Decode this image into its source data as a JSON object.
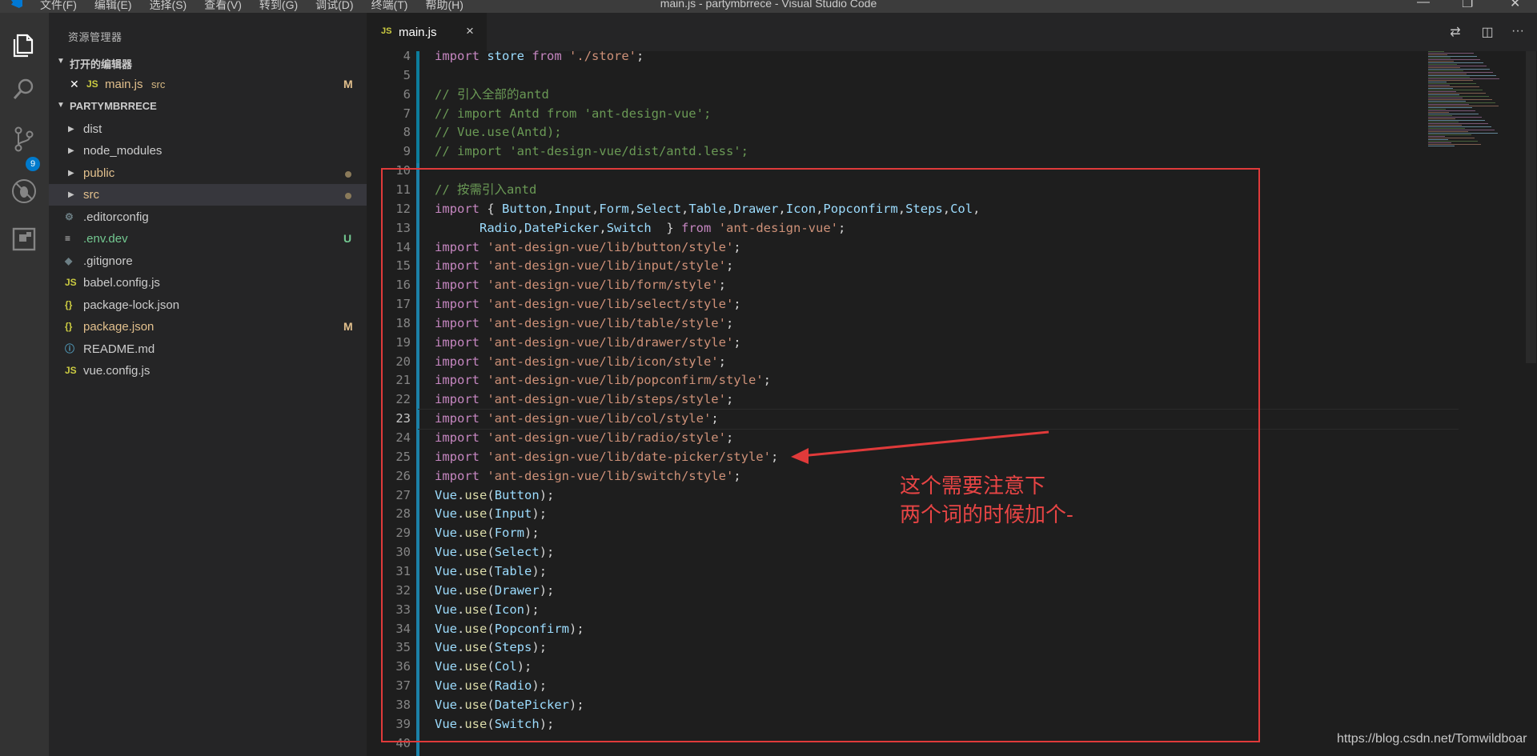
{
  "window": {
    "title": "main.js - partymbrrece - Visual Studio Code",
    "menu": [
      "文件(F)",
      "编辑(E)",
      "选择(S)",
      "查看(V)",
      "转到(G)",
      "调试(D)",
      "终端(T)",
      "帮助(H)"
    ],
    "controls": {
      "minimize": "—",
      "maximize": "❐",
      "close": "✕"
    }
  },
  "activity_bar": {
    "items": [
      "explorer-icon",
      "search-icon",
      "source-control-icon",
      "debug-icon",
      "extensions-icon"
    ],
    "scm_badge": "9"
  },
  "sidebar": {
    "title": "资源管理器",
    "open_editors": {
      "label": "打开的编辑器",
      "items": [
        {
          "icon": "JS",
          "name": "main.js",
          "dir": "src",
          "status": "M"
        }
      ]
    },
    "project": {
      "label": "PARTYMBRRECE",
      "items": [
        {
          "type": "folder",
          "name": "dist",
          "status": ""
        },
        {
          "type": "folder",
          "name": "node_modules",
          "status": ""
        },
        {
          "type": "folder",
          "name": "public",
          "status": "•"
        },
        {
          "type": "folder",
          "name": "src",
          "status": "•"
        },
        {
          "type": "file",
          "icon": "⚙",
          "name": ".editorconfig",
          "status": ""
        },
        {
          "type": "file",
          "icon": "≡",
          "name": ".env.dev",
          "status": "U"
        },
        {
          "type": "file",
          "icon": "◆",
          "name": ".gitignore",
          "status": ""
        },
        {
          "type": "file",
          "icon": "JS",
          "name": "babel.config.js",
          "status": ""
        },
        {
          "type": "file",
          "icon": "{}",
          "name": "package-lock.json",
          "status": ""
        },
        {
          "type": "file",
          "icon": "{}",
          "name": "package.json",
          "status": "M"
        },
        {
          "type": "file",
          "icon": "ⓘ",
          "name": "README.md",
          "status": ""
        },
        {
          "type": "file",
          "icon": "JS",
          "name": "vue.config.js",
          "status": ""
        }
      ]
    }
  },
  "tabs": {
    "active": {
      "icon": "JS",
      "label": "main.js",
      "close": "×"
    },
    "actions": [
      "⇄",
      "◫",
      "···"
    ]
  },
  "editor": {
    "current_line": "23",
    "lines": [
      {
        "n": "4",
        "parts": [
          [
            "kw",
            "import"
          ],
          [
            "pn",
            " "
          ],
          [
            "vr",
            "store"
          ],
          [
            "pn",
            " "
          ],
          [
            "kw",
            "from"
          ],
          [
            "pn",
            " "
          ],
          [
            "str",
            "'./store'"
          ],
          [
            "pn",
            ";"
          ]
        ]
      },
      {
        "n": "5",
        "parts": []
      },
      {
        "n": "6",
        "parts": [
          [
            "cmt",
            "// 引入全部的antd"
          ]
        ]
      },
      {
        "n": "7",
        "parts": [
          [
            "cmt",
            "// import Antd from 'ant-design-vue';"
          ]
        ]
      },
      {
        "n": "8",
        "parts": [
          [
            "cmt",
            "// Vue.use(Antd);"
          ]
        ]
      },
      {
        "n": "9",
        "parts": [
          [
            "cmt",
            "// import 'ant-design-vue/dist/antd.less';"
          ]
        ]
      },
      {
        "n": "10",
        "parts": []
      },
      {
        "n": "11",
        "parts": [
          [
            "cmt",
            "// 按需引入antd"
          ]
        ]
      },
      {
        "n": "12",
        "parts": [
          [
            "kw",
            "import"
          ],
          [
            "pn",
            " { "
          ],
          [
            "vr",
            "Button"
          ],
          [
            "pn",
            ","
          ],
          [
            "vr",
            "Input"
          ],
          [
            "pn",
            ","
          ],
          [
            "vr",
            "Form"
          ],
          [
            "pn",
            ","
          ],
          [
            "vr",
            "Select"
          ],
          [
            "pn",
            ","
          ],
          [
            "vr",
            "Table"
          ],
          [
            "pn",
            ","
          ],
          [
            "vr",
            "Drawer"
          ],
          [
            "pn",
            ","
          ],
          [
            "vr",
            "Icon"
          ],
          [
            "pn",
            ","
          ],
          [
            "vr",
            "Popconfirm"
          ],
          [
            "pn",
            ","
          ],
          [
            "vr",
            "Steps"
          ],
          [
            "pn",
            ","
          ],
          [
            "vr",
            "Col"
          ],
          [
            "pn",
            ","
          ]
        ]
      },
      {
        "n": "13",
        "parts": [
          [
            "pn",
            "      "
          ],
          [
            "vr",
            "Radio"
          ],
          [
            "pn",
            ","
          ],
          [
            "vr",
            "DatePicker"
          ],
          [
            "pn",
            ","
          ],
          [
            "vr",
            "Switch"
          ],
          [
            "pn",
            "  } "
          ],
          [
            "kw",
            "from"
          ],
          [
            "pn",
            " "
          ],
          [
            "str",
            "'ant-design-vue'"
          ],
          [
            "pn",
            ";"
          ]
        ]
      },
      {
        "n": "14",
        "parts": [
          [
            "kw",
            "import"
          ],
          [
            "pn",
            " "
          ],
          [
            "str",
            "'ant-design-vue/lib/button/style'"
          ],
          [
            "pn",
            ";"
          ]
        ]
      },
      {
        "n": "15",
        "parts": [
          [
            "kw",
            "import"
          ],
          [
            "pn",
            " "
          ],
          [
            "str",
            "'ant-design-vue/lib/input/style'"
          ],
          [
            "pn",
            ";"
          ]
        ]
      },
      {
        "n": "16",
        "parts": [
          [
            "kw",
            "import"
          ],
          [
            "pn",
            " "
          ],
          [
            "str",
            "'ant-design-vue/lib/form/style'"
          ],
          [
            "pn",
            ";"
          ]
        ]
      },
      {
        "n": "17",
        "parts": [
          [
            "kw",
            "import"
          ],
          [
            "pn",
            " "
          ],
          [
            "str",
            "'ant-design-vue/lib/select/style'"
          ],
          [
            "pn",
            ";"
          ]
        ]
      },
      {
        "n": "18",
        "parts": [
          [
            "kw",
            "import"
          ],
          [
            "pn",
            " "
          ],
          [
            "str",
            "'ant-design-vue/lib/table/style'"
          ],
          [
            "pn",
            ";"
          ]
        ]
      },
      {
        "n": "19",
        "parts": [
          [
            "kw",
            "import"
          ],
          [
            "pn",
            " "
          ],
          [
            "str",
            "'ant-design-vue/lib/drawer/style'"
          ],
          [
            "pn",
            ";"
          ]
        ]
      },
      {
        "n": "20",
        "parts": [
          [
            "kw",
            "import"
          ],
          [
            "pn",
            " "
          ],
          [
            "str",
            "'ant-design-vue/lib/icon/style'"
          ],
          [
            "pn",
            ";"
          ]
        ]
      },
      {
        "n": "21",
        "parts": [
          [
            "kw",
            "import"
          ],
          [
            "pn",
            " "
          ],
          [
            "str",
            "'ant-design-vue/lib/popconfirm/style'"
          ],
          [
            "pn",
            ";"
          ]
        ]
      },
      {
        "n": "22",
        "parts": [
          [
            "kw",
            "import"
          ],
          [
            "pn",
            " "
          ],
          [
            "str",
            "'ant-design-vue/lib/steps/style'"
          ],
          [
            "pn",
            ";"
          ]
        ]
      },
      {
        "n": "23",
        "parts": [
          [
            "kw",
            "import"
          ],
          [
            "pn",
            " "
          ],
          [
            "str",
            "'ant-design-vue/lib/col/style'"
          ],
          [
            "pn",
            ";"
          ]
        ]
      },
      {
        "n": "24",
        "parts": [
          [
            "kw",
            "import"
          ],
          [
            "pn",
            " "
          ],
          [
            "str",
            "'ant-design-vue/lib/radio/style'"
          ],
          [
            "pn",
            ";"
          ]
        ]
      },
      {
        "n": "25",
        "parts": [
          [
            "kw",
            "import"
          ],
          [
            "pn",
            " "
          ],
          [
            "str",
            "'ant-design-vue/lib/date-picker/style'"
          ],
          [
            "pn",
            ";"
          ]
        ]
      },
      {
        "n": "26",
        "parts": [
          [
            "kw",
            "import"
          ],
          [
            "pn",
            " "
          ],
          [
            "str",
            "'ant-design-vue/lib/switch/style'"
          ],
          [
            "pn",
            ";"
          ]
        ]
      },
      {
        "n": "27",
        "parts": [
          [
            "vr",
            "Vue"
          ],
          [
            "pn",
            "."
          ],
          [
            "fn",
            "use"
          ],
          [
            "pn",
            "("
          ],
          [
            "vr",
            "Button"
          ],
          [
            "pn",
            ");"
          ]
        ]
      },
      {
        "n": "28",
        "parts": [
          [
            "vr",
            "Vue"
          ],
          [
            "pn",
            "."
          ],
          [
            "fn",
            "use"
          ],
          [
            "pn",
            "("
          ],
          [
            "vr",
            "Input"
          ],
          [
            "pn",
            ");"
          ]
        ]
      },
      {
        "n": "29",
        "parts": [
          [
            "vr",
            "Vue"
          ],
          [
            "pn",
            "."
          ],
          [
            "fn",
            "use"
          ],
          [
            "pn",
            "("
          ],
          [
            "vr",
            "Form"
          ],
          [
            "pn",
            ");"
          ]
        ]
      },
      {
        "n": "30",
        "parts": [
          [
            "vr",
            "Vue"
          ],
          [
            "pn",
            "."
          ],
          [
            "fn",
            "use"
          ],
          [
            "pn",
            "("
          ],
          [
            "vr",
            "Select"
          ],
          [
            "pn",
            ");"
          ]
        ]
      },
      {
        "n": "31",
        "parts": [
          [
            "vr",
            "Vue"
          ],
          [
            "pn",
            "."
          ],
          [
            "fn",
            "use"
          ],
          [
            "pn",
            "("
          ],
          [
            "vr",
            "Table"
          ],
          [
            "pn",
            ");"
          ]
        ]
      },
      {
        "n": "32",
        "parts": [
          [
            "vr",
            "Vue"
          ],
          [
            "pn",
            "."
          ],
          [
            "fn",
            "use"
          ],
          [
            "pn",
            "("
          ],
          [
            "vr",
            "Drawer"
          ],
          [
            "pn",
            ");"
          ]
        ]
      },
      {
        "n": "33",
        "parts": [
          [
            "vr",
            "Vue"
          ],
          [
            "pn",
            "."
          ],
          [
            "fn",
            "use"
          ],
          [
            "pn",
            "("
          ],
          [
            "vr",
            "Icon"
          ],
          [
            "pn",
            ");"
          ]
        ]
      },
      {
        "n": "34",
        "parts": [
          [
            "vr",
            "Vue"
          ],
          [
            "pn",
            "."
          ],
          [
            "fn",
            "use"
          ],
          [
            "pn",
            "("
          ],
          [
            "vr",
            "Popconfirm"
          ],
          [
            "pn",
            ");"
          ]
        ]
      },
      {
        "n": "35",
        "parts": [
          [
            "vr",
            "Vue"
          ],
          [
            "pn",
            "."
          ],
          [
            "fn",
            "use"
          ],
          [
            "pn",
            "("
          ],
          [
            "vr",
            "Steps"
          ],
          [
            "pn",
            ");"
          ]
        ]
      },
      {
        "n": "36",
        "parts": [
          [
            "vr",
            "Vue"
          ],
          [
            "pn",
            "."
          ],
          [
            "fn",
            "use"
          ],
          [
            "pn",
            "("
          ],
          [
            "vr",
            "Col"
          ],
          [
            "pn",
            ");"
          ]
        ]
      },
      {
        "n": "37",
        "parts": [
          [
            "vr",
            "Vue"
          ],
          [
            "pn",
            "."
          ],
          [
            "fn",
            "use"
          ],
          [
            "pn",
            "("
          ],
          [
            "vr",
            "Radio"
          ],
          [
            "pn",
            ");"
          ]
        ]
      },
      {
        "n": "38",
        "parts": [
          [
            "vr",
            "Vue"
          ],
          [
            "pn",
            "."
          ],
          [
            "fn",
            "use"
          ],
          [
            "pn",
            "("
          ],
          [
            "vr",
            "DatePicker"
          ],
          [
            "pn",
            ");"
          ]
        ]
      },
      {
        "n": "39",
        "parts": [
          [
            "vr",
            "Vue"
          ],
          [
            "pn",
            "."
          ],
          [
            "fn",
            "use"
          ],
          [
            "pn",
            "("
          ],
          [
            "vr",
            "Switch"
          ],
          [
            "pn",
            ");"
          ]
        ]
      },
      {
        "n": "40",
        "parts": []
      }
    ]
  },
  "annotation": {
    "note_line1": "这个需要注意下",
    "note_line2": "两个词的时候加个-",
    "color": "#e03a3a"
  },
  "watermark": "https://blog.csdn.net/Tomwildboar"
}
